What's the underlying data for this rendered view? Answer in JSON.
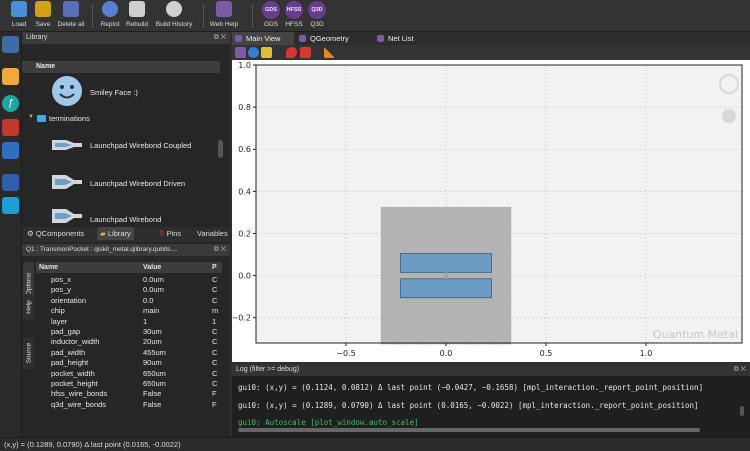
{
  "toolbar": {
    "buttons": [
      {
        "label": "Load",
        "color": "#4a90d9"
      },
      {
        "label": "Save",
        "color": "#d4a017"
      },
      {
        "label": "Delete all",
        "color": "#5b6fb8"
      },
      {
        "label": "Replot",
        "color": "#5b7fd6"
      },
      {
        "label": "Rebuild",
        "color": "#cfcfcf"
      },
      {
        "label": "Build History",
        "color": "#d0d0d0"
      },
      {
        "label": "Web Help",
        "color": "#7b5aa6"
      }
    ],
    "renderers": [
      {
        "chip": "GDS",
        "label": "GDS"
      },
      {
        "chip": "HFSS",
        "label": "HFSS"
      },
      {
        "chip": "Q3D",
        "label": "Q3D"
      }
    ]
  },
  "library": {
    "title": "Library",
    "column_header": "Name",
    "items": [
      {
        "label": "Smiley Face :)",
        "icon": "smiley-icon"
      },
      {
        "label": "terminations",
        "icon": "folder-icon"
      },
      {
        "label": "Launchpad Wirebond Coupled",
        "icon": "launchpad-icon"
      },
      {
        "label": "Launchpad Wirebond Driven",
        "icon": "launchpad-icon"
      },
      {
        "label": "Launchpad Wirebond",
        "icon": "launchpad-icon"
      }
    ],
    "tabs": [
      "QComponents",
      "Library",
      "Pins",
      "Variables"
    ]
  },
  "qcomponent": {
    "title": "Q1  :  TransmonPocket  :  qiskit_metal.qlibrary.qubits....",
    "vtabs": [
      "Options",
      "Help",
      "Source"
    ],
    "headers": {
      "name": "Name",
      "value": "Value",
      "parsed": "P"
    },
    "rows": [
      {
        "name": "pos_x",
        "value": "0.0um",
        "p": "C"
      },
      {
        "name": "pos_y",
        "value": "0.0um",
        "p": "C"
      },
      {
        "name": "orientation",
        "value": "0.0",
        "p": "C"
      },
      {
        "name": "chip",
        "value": "main",
        "p": "m"
      },
      {
        "name": "layer",
        "value": "1",
        "p": "1"
      },
      {
        "name": "pad_gap",
        "value": "30um",
        "p": "C"
      },
      {
        "name": "inductor_width",
        "value": "20um",
        "p": "C"
      },
      {
        "name": "pad_width",
        "value": "455um",
        "p": "C"
      },
      {
        "name": "pad_height",
        "value": "90um",
        "p": "C"
      },
      {
        "name": "pocket_width",
        "value": "650um",
        "p": "C"
      },
      {
        "name": "pocket_height",
        "value": "650um",
        "p": "C"
      },
      {
        "name": "hfss_wire_bonds",
        "value": "False",
        "p": "F"
      },
      {
        "name": "q3d_wire_bonds",
        "value": "False",
        "p": "F"
      }
    ]
  },
  "main_view": {
    "tabs": [
      "Main View",
      "QGeometry",
      "Net List"
    ],
    "watermark": "Quantum Metal"
  },
  "chart_data": {
    "type": "scatter",
    "title": "",
    "xlabel": "",
    "ylabel": "",
    "xlim": [
      -0.95,
      1.48
    ],
    "ylim": [
      -0.32,
      1.0
    ],
    "xticks": [
      -0.5,
      0.0,
      0.5,
      1.0
    ],
    "xtick_labels": [
      "−0.5",
      "0.0",
      "0.5",
      "1.0"
    ],
    "yticks": [
      -0.2,
      0.0,
      0.2,
      0.4,
      0.6,
      0.8,
      1.0
    ],
    "ytick_labels": [
      "−0.2",
      "0.0",
      "0.2",
      "0.4",
      "0.6",
      "0.8",
      "1.0"
    ],
    "grid": true,
    "shapes": [
      {
        "name": "pocket",
        "x0": -0.325,
        "x1": 0.325,
        "y0": -0.325,
        "y1": 0.325,
        "color": "#b3b3b3"
      },
      {
        "name": "pad-top",
        "x0": -0.2275,
        "x1": 0.2275,
        "y0": 0.015,
        "y1": 0.105,
        "color": "#6b9bc3"
      },
      {
        "name": "pad-bottom",
        "x0": -0.2275,
        "x1": 0.2275,
        "y0": -0.105,
        "y1": -0.015,
        "color": "#6b9bc3"
      }
    ]
  },
  "log": {
    "title": "Log  (filter >= debug)",
    "lines": [
      {
        "text": "gui0: (x,y) = (0.1124, 0.0812)  Δ last point (−0.0427, −0.1658) [mpl_interaction._report_point_position]",
        "color": "#e6e6e6"
      },
      {
        "text": "gui0: (x,y) = (0.1289, 0.0790)  Δ last point (0.0165, −0.0022) [mpl_interaction._report_point_position]",
        "color": "#e6e6e6"
      },
      {
        "text": "gui0: Autoscale [plot_window.auto_scale]",
        "color": "#3fbf5f"
      }
    ]
  },
  "status": {
    "text": "(x,y) = (0.1289, 0.0790)  Δ last point (0.0165, -0.0022)"
  }
}
